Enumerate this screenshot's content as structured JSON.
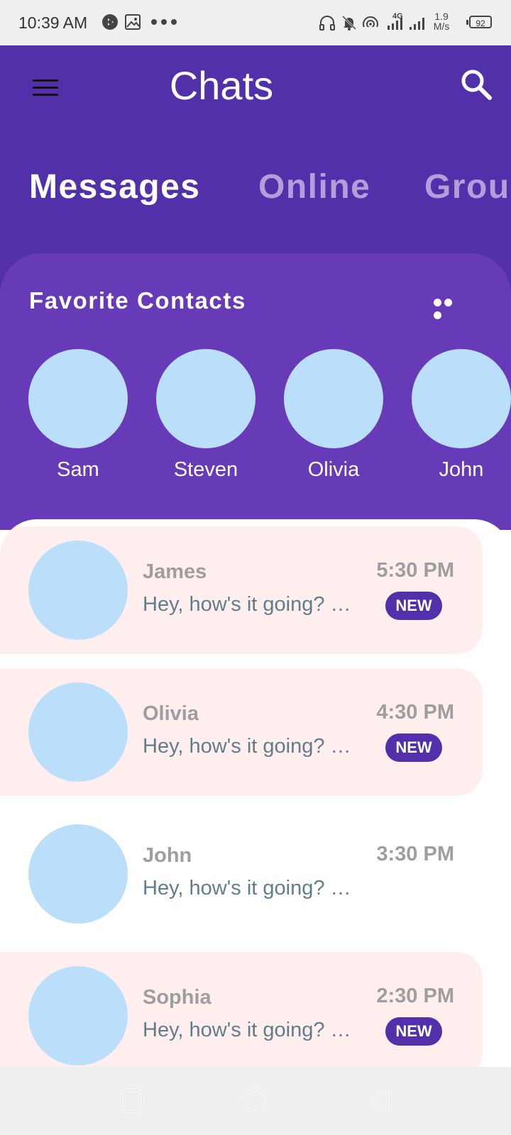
{
  "status_bar": {
    "time": "10:39 AM",
    "speed_value": "1.9",
    "speed_unit": "M/s",
    "network_label": "4G",
    "battery": "92"
  },
  "header": {
    "title": "Chats",
    "menu_icon": "hamburger-menu-icon",
    "search_icon": "search-icon",
    "tabs": [
      {
        "label": "Messages",
        "active": true
      },
      {
        "label": "Online",
        "active": false
      },
      {
        "label": "Groups",
        "active": false
      }
    ]
  },
  "favorites": {
    "title": "Favorite Contacts",
    "more_icon": "more-horizontal-icon",
    "contacts": [
      {
        "name": "Sam"
      },
      {
        "name": "Steven"
      },
      {
        "name": "Olivia"
      },
      {
        "name": "John"
      }
    ]
  },
  "chats": [
    {
      "name": "James",
      "message": "Hey, how's it going? What did you do today?",
      "time": "5:30 PM",
      "unread": true,
      "badge": "NEW"
    },
    {
      "name": "Olivia",
      "message": "Hey, how's it going? What did you do today?",
      "time": "4:30 PM",
      "unread": true,
      "badge": "NEW"
    },
    {
      "name": "John",
      "message": "Hey, how's it going? What did you do today?",
      "time": "3:30 PM",
      "unread": false,
      "badge": ""
    },
    {
      "name": "Sophia",
      "message": "Hey, how's it going? What did you do today?",
      "time": "2:30 PM",
      "unread": true,
      "badge": "NEW"
    }
  ],
  "colors": {
    "primary": "#5230aa",
    "panel": "#673ab7",
    "avatar": "#bbdefb",
    "unread_bg": "#ffeeee",
    "tab_inactive": "#b39ddb"
  },
  "nav_bar": {
    "recents_icon": "square-recents-icon",
    "home_icon": "circle-home-icon",
    "back_icon": "triangle-back-icon"
  }
}
